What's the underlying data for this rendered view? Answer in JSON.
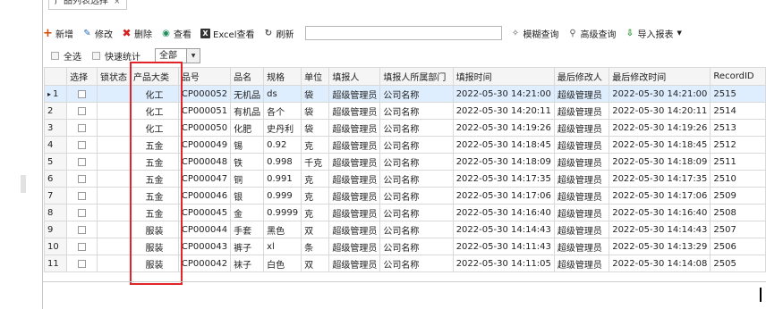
{
  "tab": {
    "label": "产品列表选择",
    "close": "×"
  },
  "toolbar": {
    "add": "新增",
    "edit": "修改",
    "delete": "删除",
    "view": "查看",
    "excel": "Excel查看",
    "refresh": "刷新",
    "search_value": "",
    "fuzzy": "模糊查询",
    "advanced": "高级查询",
    "import": "导入报表"
  },
  "filterbar": {
    "select_all": "全选",
    "quick_stats": "快速统计",
    "scope_value": "全部"
  },
  "columns": [
    "选择",
    "锁状态",
    "产品大类",
    "品号",
    "品名",
    "规格",
    "单位",
    "填报人",
    "填报人所属部门",
    "填报时间",
    "最后修改人",
    "最后修改时间",
    "RecordID"
  ],
  "rows": [
    {
      "idx": "1",
      "cat": "化工",
      "code": "CP000052",
      "name": "无机品",
      "spec": "ds",
      "unit": "袋",
      "reporter": "超级管理员",
      "dept": "公司名称",
      "time": "2022-05-30 14:21:00",
      "modifier": "超级管理员",
      "mtime": "2022-05-30 14:21:00",
      "rid": "2515"
    },
    {
      "idx": "2",
      "cat": "化工",
      "code": "CP000051",
      "name": "有机品",
      "spec": "各个",
      "unit": "袋",
      "reporter": "超级管理员",
      "dept": "公司名称",
      "time": "2022-05-30 14:20:11",
      "modifier": "超级管理员",
      "mtime": "2022-05-30 14:20:11",
      "rid": "2514"
    },
    {
      "idx": "3",
      "cat": "化工",
      "code": "CP000050",
      "name": "化肥",
      "spec": "史丹利",
      "unit": "袋",
      "reporter": "超级管理员",
      "dept": "公司名称",
      "time": "2022-05-30 14:19:26",
      "modifier": "超级管理员",
      "mtime": "2022-05-30 14:19:26",
      "rid": "2513"
    },
    {
      "idx": "4",
      "cat": "五金",
      "code": "CP000049",
      "name": "锡",
      "spec": "0.92",
      "unit": "克",
      "reporter": "超级管理员",
      "dept": "公司名称",
      "time": "2022-05-30 14:18:45",
      "modifier": "超级管理员",
      "mtime": "2022-05-30 14:18:45",
      "rid": "2512"
    },
    {
      "idx": "5",
      "cat": "五金",
      "code": "CP000048",
      "name": "铁",
      "spec": "0.998",
      "unit": "千克",
      "reporter": "超级管理员",
      "dept": "公司名称",
      "time": "2022-05-30 14:18:09",
      "modifier": "超级管理员",
      "mtime": "2022-05-30 14:18:09",
      "rid": "2511"
    },
    {
      "idx": "6",
      "cat": "五金",
      "code": "CP000047",
      "name": "铜",
      "spec": "0.991",
      "unit": "克",
      "reporter": "超级管理员",
      "dept": "公司名称",
      "time": "2022-05-30 14:17:35",
      "modifier": "超级管理员",
      "mtime": "2022-05-30 14:17:35",
      "rid": "2510"
    },
    {
      "idx": "7",
      "cat": "五金",
      "code": "CP000046",
      "name": "银",
      "spec": "0.999",
      "unit": "克",
      "reporter": "超级管理员",
      "dept": "公司名称",
      "time": "2022-05-30 14:17:06",
      "modifier": "超级管理员",
      "mtime": "2022-05-30 14:17:06",
      "rid": "2509"
    },
    {
      "idx": "8",
      "cat": "五金",
      "code": "CP000045",
      "name": "金",
      "spec": "0.9999",
      "unit": "克",
      "reporter": "超级管理员",
      "dept": "公司名称",
      "time": "2022-05-30 14:16:40",
      "modifier": "超级管理员",
      "mtime": "2022-05-30 14:16:40",
      "rid": "2508"
    },
    {
      "idx": "9",
      "cat": "服装",
      "code": "CP000044",
      "name": "手套",
      "spec": "黑色",
      "unit": "双",
      "reporter": "超级管理员",
      "dept": "公司名称",
      "time": "2022-05-30 14:14:43",
      "modifier": "超级管理员",
      "mtime": "2022-05-30 14:14:43",
      "rid": "2507"
    },
    {
      "idx": "10",
      "cat": "服装",
      "code": "CP000043",
      "name": "裤子",
      "spec": "xl",
      "unit": "条",
      "reporter": "超级管理员",
      "dept": "公司名称",
      "time": "2022-05-30 14:11:43",
      "modifier": "超级管理员",
      "mtime": "2022-05-30 14:13:29",
      "rid": "2506"
    },
    {
      "idx": "11",
      "cat": "服装",
      "code": "CP000042",
      "name": "袜子",
      "spec": "白色",
      "unit": "双",
      "reporter": "超级管理员",
      "dept": "公司名称",
      "time": "2022-05-30 14:11:05",
      "modifier": "超级管理员",
      "mtime": "2022-05-30 14:14:08",
      "rid": "2505"
    }
  ],
  "selected_row_marker": "▸",
  "colors": {
    "highlight": "#e0242a",
    "selected_row": "#dfeefe",
    "add_icon": "#d04a00",
    "delete_icon": "#d41f1f",
    "view_icon": "#1e8f5a",
    "import_icon": "#1c8b2c"
  },
  "icons": {
    "add": "plus-icon",
    "edit": "pencil-icon",
    "delete": "cross-icon",
    "view": "eye-icon",
    "excel": "excel-icon",
    "refresh": "refresh-icon",
    "fuzzy": "magic-wand-icon",
    "advanced": "magnifier-icon",
    "import": "import-icon"
  }
}
